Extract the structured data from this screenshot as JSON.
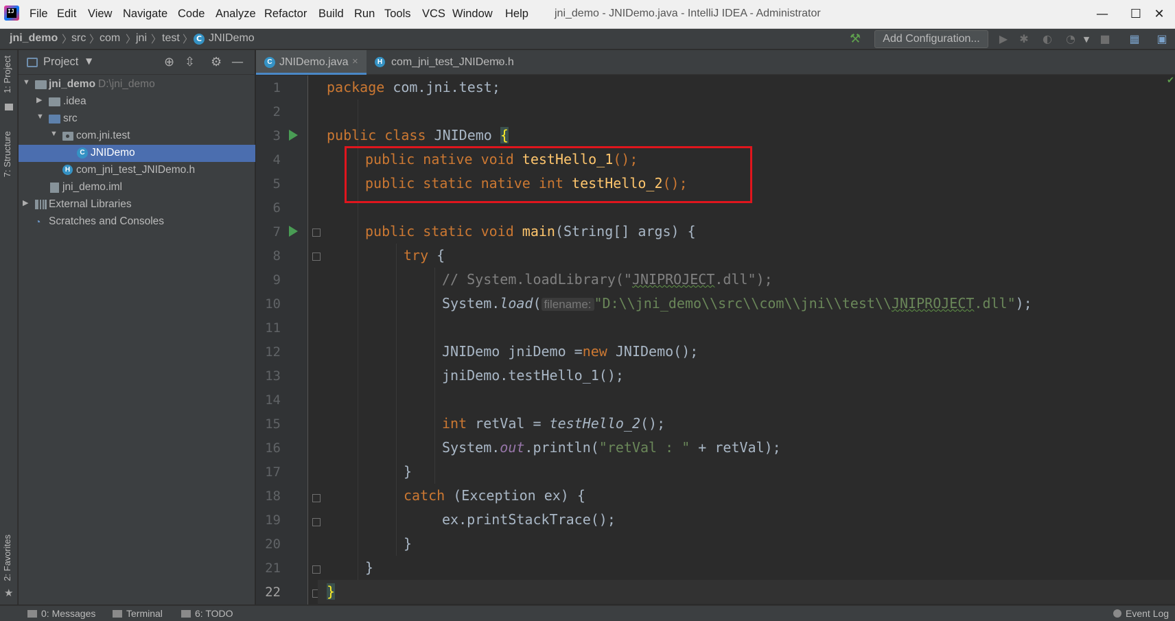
{
  "menubar": {
    "items": [
      "File",
      "Edit",
      "View",
      "Navigate",
      "Code",
      "Analyze",
      "Refactor",
      "Build",
      "Run",
      "Tools",
      "VCS",
      "Window",
      "Help"
    ],
    "title": "jni_demo - JNIDemo.java - IntelliJ IDEA - Administrator",
    "logo_text": "IJ",
    "minimize": "—",
    "maximize": "☐",
    "close": "✕"
  },
  "breadcrumb": [
    "jni_demo",
    "src",
    "com",
    "jni",
    "test",
    "JNIDemo"
  ],
  "toolbar": {
    "add_configuration": "Add Configuration..."
  },
  "left_strip": {
    "project_tab": "1: Project",
    "structure_tab": "7: Structure",
    "favorites_tab": "2: Favorites"
  },
  "project_panel": {
    "title": "Project",
    "tree": [
      {
        "label": "jni_demo",
        "sub": "D:\\jni_demo"
      },
      {
        "label": ".idea"
      },
      {
        "label": "src"
      },
      {
        "label": "com.jni.test"
      },
      {
        "label": "JNIDemo"
      },
      {
        "label": "com_jni_test_JNIDemo.h"
      },
      {
        "label": "jni_demo.iml"
      },
      {
        "label": "External Libraries"
      },
      {
        "label": "Scratches and Consoles"
      }
    ]
  },
  "editor_tabs": [
    {
      "label": "JNIDemo.java",
      "icon": "java-class-icon",
      "active": true
    },
    {
      "label": "com_jni_test_JNIDemo.h",
      "icon": "header-file-icon",
      "active": false
    }
  ],
  "editor": {
    "line_numbers": [
      "1",
      "2",
      "3",
      "4",
      "5",
      "6",
      "7",
      "8",
      "9",
      "10",
      "11",
      "12",
      "13",
      "14",
      "15",
      "16",
      "17",
      "18",
      "19",
      "20",
      "21",
      "22"
    ],
    "code": {
      "l1_kw": "package",
      "l1_rest": " com.jni.test;",
      "l3_kw": "public class",
      "l3_name": " JNIDemo ",
      "l3_brace": "{",
      "l4_kw": "public native void",
      "l4_fn": "testHello_1",
      "l4_rest": "();",
      "l5_kw": "public static native int",
      "l5_fn": "testHello_2",
      "l5_rest": "();",
      "l7_kw": "public static void",
      "l7_fn": "main",
      "l7_rest": "(String[] args) {",
      "l8_kw": "try",
      "l8_rest": " {",
      "l9_cmt_a": "// System.loadLibrary(\"",
      "l9_cmt_b": "JNIPROJECT",
      "l9_cmt_c": ".dll\");",
      "l10_a": "System.",
      "l10_fn": "load",
      "l10_b": "(",
      "l10_hint": "filename:",
      "l10_str_a": "\"D:\\\\jni_demo\\\\src\\\\com\\\\jni\\\\test\\\\",
      "l10_str_b": "JNIPROJECT",
      "l10_str_c": ".dll\"",
      "l10_end": ");",
      "l12_a": "JNIDemo jniDemo =",
      "l12_kw": "new",
      "l12_b": " JNIDemo();",
      "l13_a": "jniDemo.testHello_1();",
      "l15_kw": "int",
      "l15_a": " retVal = ",
      "l15_fn": "testHello_2",
      "l15_b": "();",
      "l16_a": "System.",
      "l16_field": "out",
      "l16_b": ".println(",
      "l16_str": "\"retVal : \"",
      "l16_c": " + retVal);",
      "l17": "}",
      "l18_kw": "catch",
      "l18_rest": " (Exception ex) {",
      "l19": "ex.printStackTrace();",
      "l20": "}",
      "l21": "}",
      "l22": "}"
    }
  },
  "bottom_bar": {
    "messages": "0: Messages",
    "terminal": "Terminal",
    "todo": "6: TODO",
    "event_log": "Event Log"
  },
  "colors": {
    "keyword": "#cc7832",
    "function": "#ffc66d",
    "string": "#6a8759",
    "comment": "#808080",
    "highlight_box": "#e0151d",
    "selection": "#4b6eaf"
  }
}
